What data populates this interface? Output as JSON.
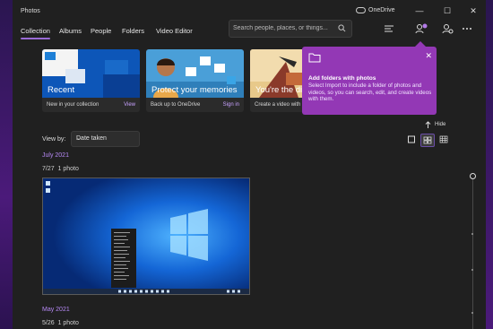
{
  "window": {
    "app_title": "Photos",
    "onedrive_label": "OneDrive",
    "minimize": "—",
    "maximize": "☐",
    "close": "✕"
  },
  "nav": {
    "tabs": [
      {
        "label": "Collection"
      },
      {
        "label": "Albums"
      },
      {
        "label": "People"
      },
      {
        "label": "Folders"
      },
      {
        "label": "Video Editor"
      }
    ]
  },
  "search": {
    "placeholder": "Search people, places, or things..."
  },
  "cards": [
    {
      "title": "Recent",
      "desc": "New in your collection",
      "link": "View"
    },
    {
      "title": "Protect your memories",
      "desc": "Back up to OneDrive",
      "link": "Sign in"
    },
    {
      "title": "You're the dir",
      "desc": "Create a video with"
    }
  ],
  "teaching_tip": {
    "heading": "Add folders with photos",
    "body": "Select Import to include a folder of photos and videos, so you can search, edit, and create videos with them.",
    "close": "✕"
  },
  "hide_label": "Hide",
  "view_by": {
    "label": "View by:",
    "selected": "Date taken"
  },
  "groups": [
    {
      "month": "July 2021",
      "date": "7/27",
      "count": "1 photo"
    },
    {
      "month": "May 2021",
      "date": "5/26",
      "count": "1 photo"
    }
  ],
  "colors": {
    "accent": "#9a6bd6",
    "teaching_bg": "#9338b5",
    "month_text": "#b689f5",
    "desktop_blue": "#0a3c9a"
  },
  "icons": [
    "search-icon",
    "filter-icon",
    "import-icon",
    "people-sync-icon",
    "more-icon",
    "folder-icon",
    "close-icon",
    "arrow-up-icon",
    "chevron-down-icon",
    "size-small-icon",
    "size-medium-icon",
    "size-large-icon"
  ]
}
